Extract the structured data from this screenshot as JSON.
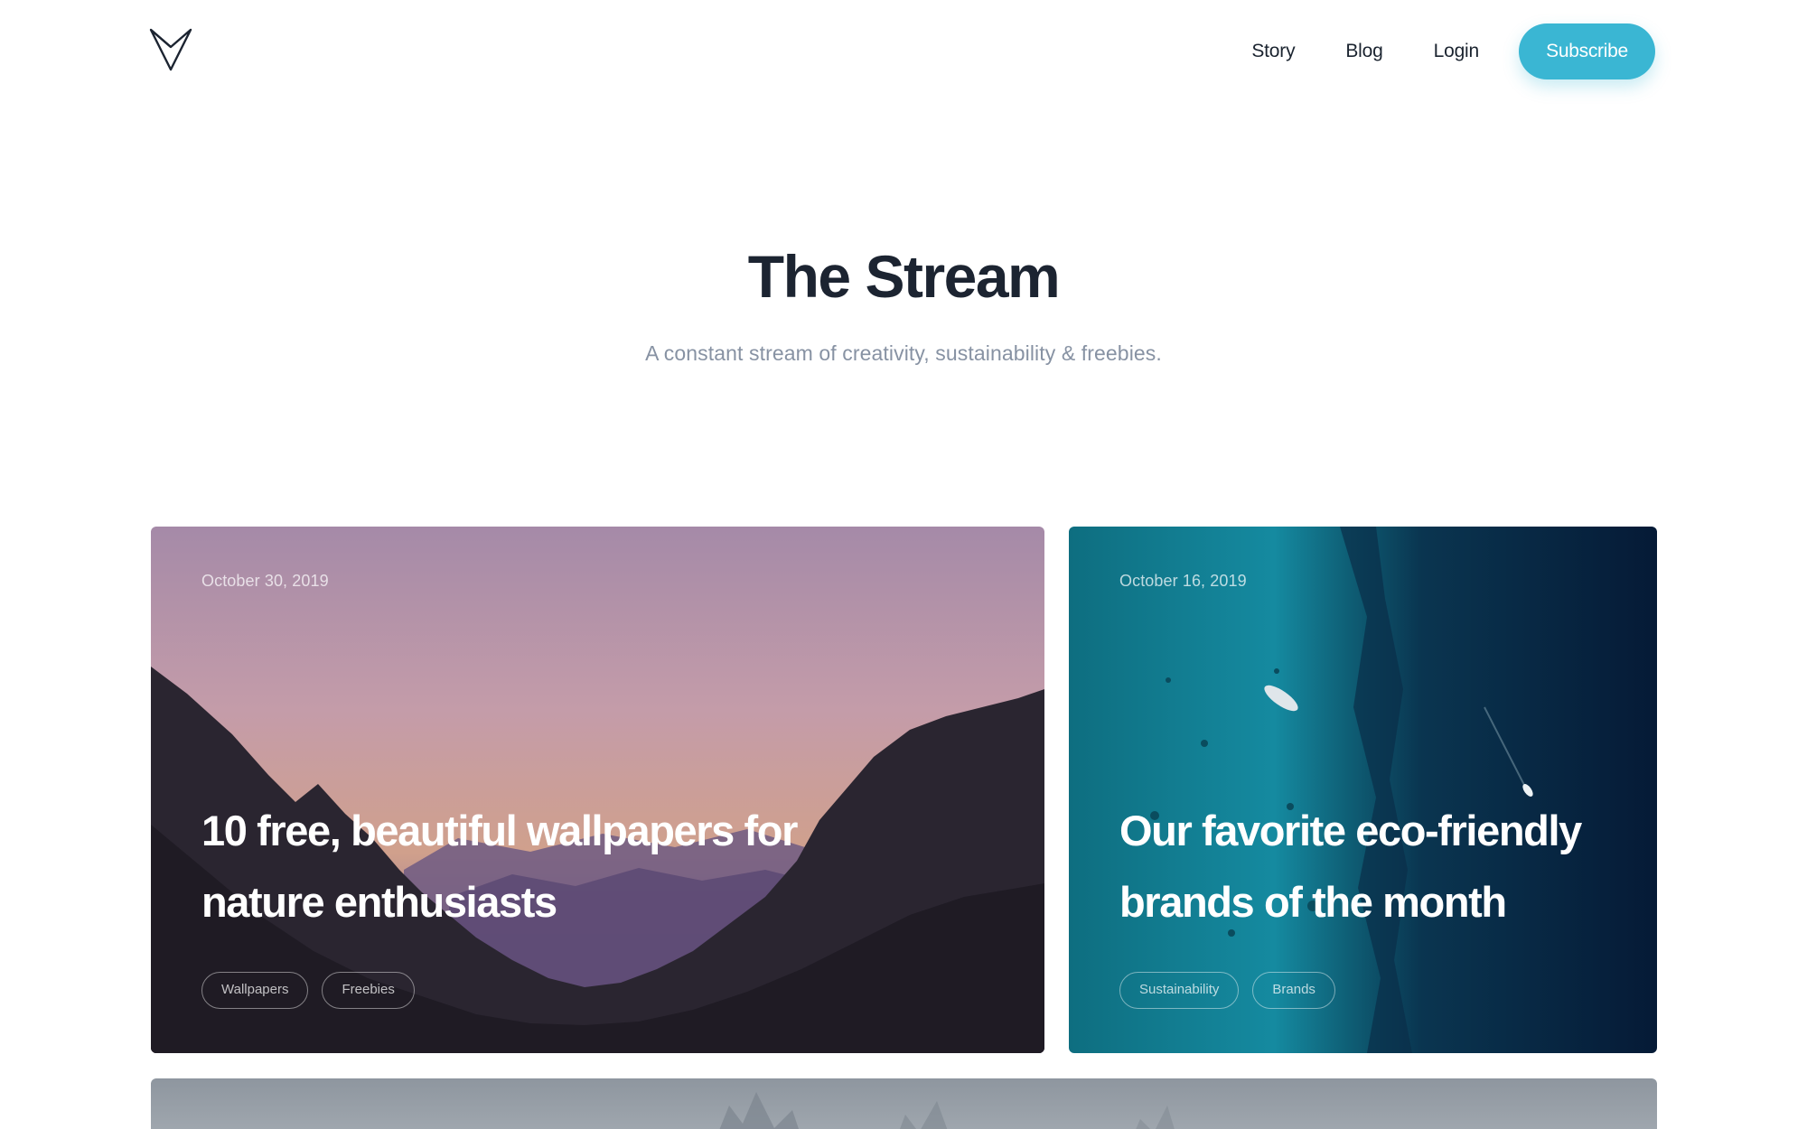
{
  "header": {
    "logo_name": "v-logo",
    "nav": [
      {
        "label": "Story"
      },
      {
        "label": "Blog"
      },
      {
        "label": "Login"
      }
    ],
    "subscribe_label": "Subscribe",
    "accent_color": "#3ab6d3"
  },
  "hero": {
    "title": "The Stream",
    "subtitle": "A constant stream of creativity, sustainability & freebies."
  },
  "posts": [
    {
      "date": "October 30, 2019",
      "title": "10 free, beautiful wallpapers for nature enthusiasts",
      "tags": [
        "Wallpapers",
        "Freebies"
      ],
      "image": "mountain-valley-sunset"
    },
    {
      "date": "October 16, 2019",
      "title": "Our favorite eco-friendly brands of the month",
      "tags": [
        "Sustainability",
        "Brands"
      ],
      "image": "ocean-aerial-boats"
    },
    {
      "image": "misty-forest"
    }
  ]
}
